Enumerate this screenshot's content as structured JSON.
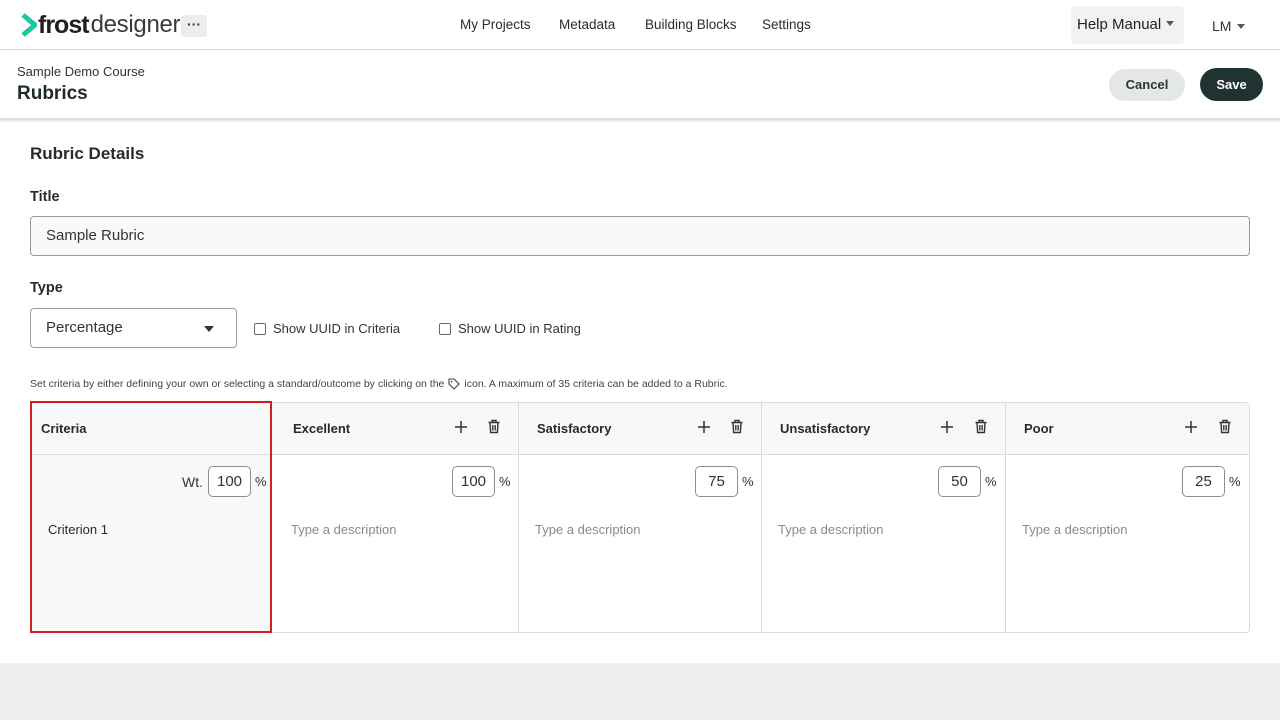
{
  "topbar": {
    "logo": {
      "frost": "frost",
      "designer": "designer"
    },
    "more_label": "···",
    "nav": [
      "My Projects",
      "Metadata",
      "Building Blocks",
      "Settings"
    ],
    "help_label": "Help Manual",
    "user_initials": "LM"
  },
  "header": {
    "breadcrumb": "Sample Demo Course",
    "title": "Rubrics",
    "cancel_label": "Cancel",
    "save_label": "Save"
  },
  "form": {
    "section_title": "Rubric Details",
    "title_label": "Title",
    "title_value": "Sample Rubric",
    "type_label": "Type",
    "type_value": "Percentage",
    "show_uuid_criteria": "Show UUID in Criteria",
    "show_uuid_rating": "Show UUID in Rating",
    "helper_before": "Set criteria by either defining your own or selecting a standard/outcome by clicking on the",
    "helper_after": "icon. A maximum of 35 criteria can be added to a Rubric."
  },
  "rubric": {
    "criteria_header": "Criteria",
    "weight_label": "Wt.",
    "weight_value": "100",
    "percent_sign": "%",
    "criteria": [
      {
        "name": "Criterion 1"
      }
    ],
    "description_placeholder": "Type a description",
    "levels": [
      {
        "label": "Excellent",
        "value": "100"
      },
      {
        "label": "Satisfactory",
        "value": "75"
      },
      {
        "label": "Unsatisfactory",
        "value": "50"
      },
      {
        "label": "Poor",
        "value": "25"
      }
    ]
  },
  "colors": {
    "accent_green": "#1fc7a1",
    "save_bg": "#213330",
    "highlight_red": "#d21e1e"
  }
}
